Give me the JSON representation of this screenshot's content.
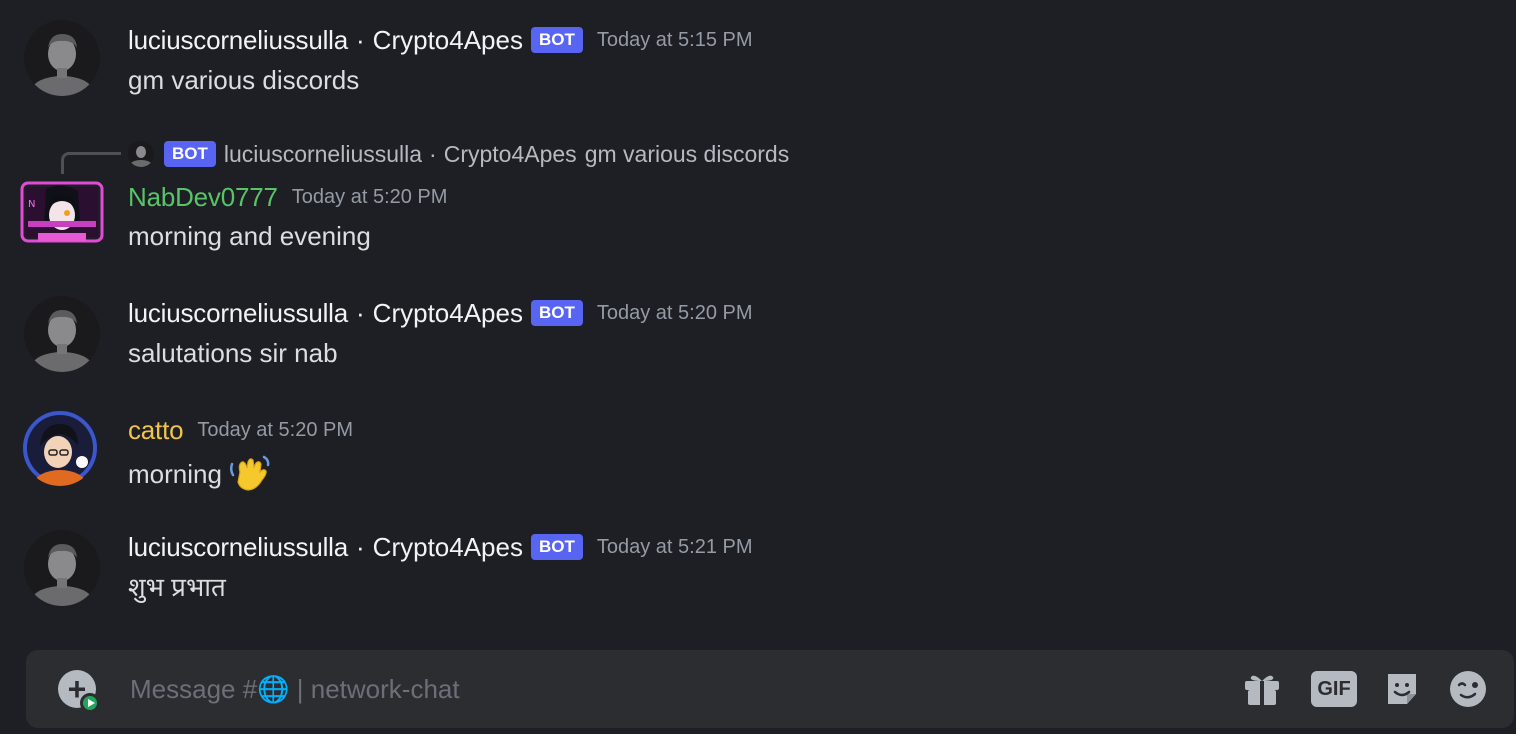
{
  "messages": [
    {
      "username": "luciuscorneliussulla",
      "server_tag": "Crypto4Apes",
      "bot_badge": "BOT",
      "timestamp": "Today at 5:15 PM",
      "text": "gm various discords"
    },
    {
      "reply": {
        "bot_badge": "BOT",
        "username": "luciuscorneliussulla",
        "server_tag": "Crypto4Apes",
        "text": "gm various discords"
      },
      "username": "NabDev0777",
      "username_color": "#57c567",
      "timestamp": "Today at 5:20 PM",
      "text": "morning and evening"
    },
    {
      "username": "luciuscorneliussulla",
      "server_tag": "Crypto4Apes",
      "bot_badge": "BOT",
      "timestamp": "Today at 5:20 PM",
      "text": "salutations sir nab"
    },
    {
      "username": "catto",
      "username_color": "#f0c34a",
      "timestamp": "Today at 5:20 PM",
      "text": "morning",
      "emoji": "waving-hand-emoji"
    },
    {
      "username": "luciuscorneliussulla",
      "server_tag": "Crypto4Apes",
      "bot_badge": "BOT",
      "timestamp": "Today at 5:21 PM",
      "text": "शुभ प्रभात"
    }
  ],
  "separator": "·",
  "composer": {
    "placeholder": "Message #🌐 | network-chat",
    "gif_label": "GIF",
    "icons": [
      "add-circle-icon",
      "gift-icon",
      "gif-icon",
      "sticker-icon",
      "emoji-icon"
    ]
  },
  "colors": {
    "background": "#1e1f24",
    "bot_badge": "#5865f2",
    "composer_bg": "#2b2d31"
  }
}
